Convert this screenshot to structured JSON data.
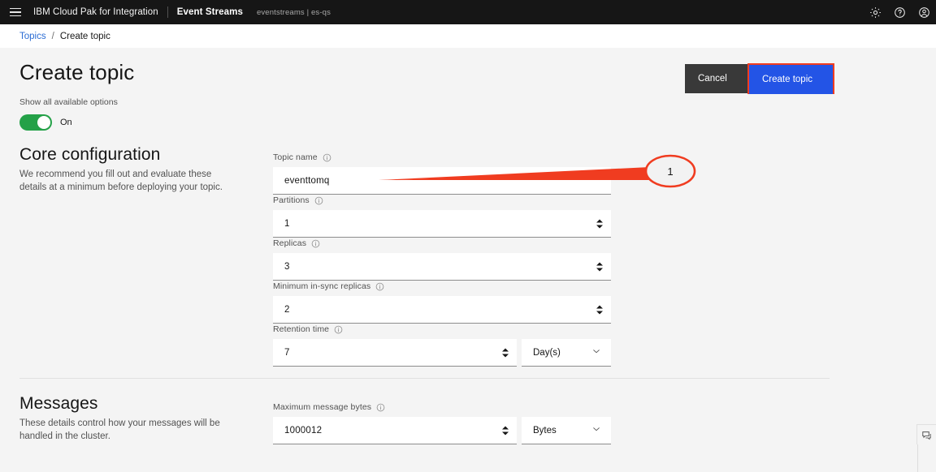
{
  "header": {
    "menu_icon": "hamburger-icon",
    "brand": "IBM Cloud Pak for Integration",
    "product": "Event Streams",
    "instance": "eventstreams | es-qs",
    "icons": [
      "gear-icon",
      "help-icon",
      "user-avatar-icon"
    ]
  },
  "breadcrumb": {
    "parent": "Topics",
    "separator": "/",
    "current": "Create topic"
  },
  "page": {
    "title": "Create topic",
    "show_all_label": "Show all available options",
    "toggle_state": "On",
    "toggle_on": true
  },
  "actions": {
    "cancel_label": "Cancel",
    "create_label": "Create topic"
  },
  "sections": [
    {
      "title": "Core configuration",
      "description": "We recommend you fill out and evaluate these details at a minimum before deploying your topic."
    },
    {
      "title": "Messages",
      "description": "These details control how your messages will be handled in the cluster."
    }
  ],
  "fields": {
    "topic_name": {
      "label": "Topic name",
      "value": "eventtomq",
      "placeholder": "Topic name"
    },
    "partitions": {
      "label": "Partitions",
      "value": "1"
    },
    "replicas": {
      "label": "Replicas",
      "value": "3"
    },
    "min_insync": {
      "label": "Minimum in-sync replicas",
      "value": "2"
    },
    "retention": {
      "label": "Retention time",
      "value": "7",
      "unit": "Day(s)"
    },
    "max_message_bytes": {
      "label": "Maximum message bytes",
      "value": "1000012",
      "unit": "Bytes"
    }
  },
  "annotations": {
    "callout_number": "1",
    "callout_color": "#f03c20",
    "highlight_target": "create-topic-button"
  },
  "feedback": {
    "icon": "feedback-chat-icon"
  },
  "colors": {
    "header_bg": "#161616",
    "page_bg": "#f4f4f4",
    "primary_button": "#2354e6",
    "secondary_button": "#393939",
    "toggle_on": "#24a148",
    "link": "#2b6cd4",
    "annotation": "#f03c20"
  }
}
